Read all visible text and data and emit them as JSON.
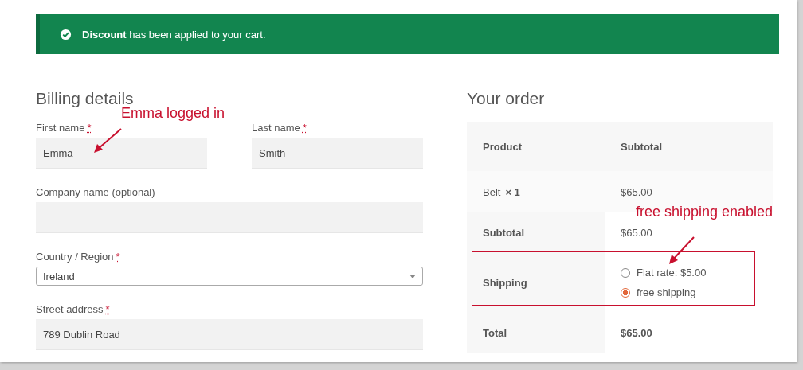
{
  "notice": {
    "message": "**Discount** has been applied to your cart."
  },
  "billing": {
    "title": "Billing details",
    "rows": [
      [
        {
          "kind": "text",
          "label": "First name",
          "required_mark": "*",
          "value": "Emma"
        },
        {
          "kind": "text",
          "label": "Last name",
          "required_mark": "*",
          "value": "Smith"
        }
      ],
      [
        {
          "kind": "text",
          "label": "Company name (optional)"
        }
      ],
      [
        {
          "kind": "select",
          "label": "Country / Region",
          "required_mark": "*",
          "value": "Ireland"
        }
      ],
      [
        {
          "kind": "text",
          "label": "Street address",
          "required_mark": "*",
          "value": "789 Dublin Road"
        }
      ]
    ]
  },
  "order": {
    "title": "Your order",
    "columns": [
      "Product",
      "Subtotal"
    ],
    "items": [
      {
        "product": "Belt",
        "quantity": "× 1",
        "subtotal": "$65.00"
      }
    ],
    "subtotal_label": "Subtotal",
    "subtotal": "$65.00",
    "shipping_label": "Shipping",
    "shipping_options": [
      {
        "label": "Flat rate: $5.00",
        "selected": false
      },
      {
        "label": "free shipping",
        "selected": true
      }
    ],
    "total_label": "Total",
    "total": "$65.00"
  },
  "annotations": [
    {
      "text": "Emma logged in"
    },
    {
      "text": "free shipping enabled"
    }
  ]
}
